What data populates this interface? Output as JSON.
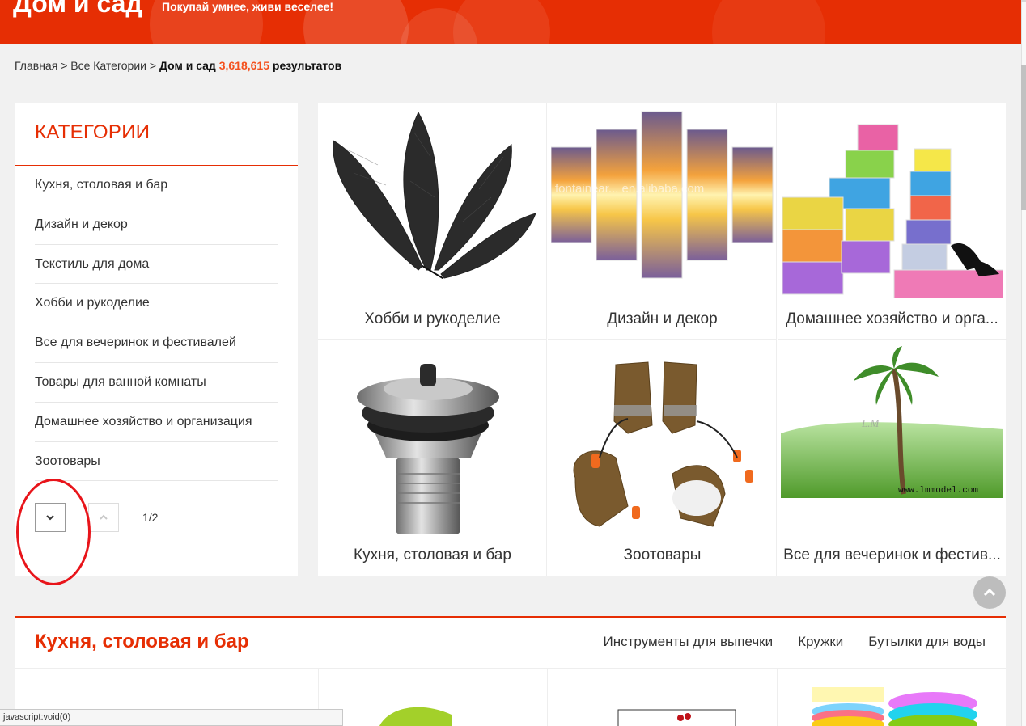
{
  "banner": {
    "title": "Дом и сад",
    "slogan": "Покупай умнее, живи веселее!"
  },
  "breadcrumb": {
    "home": "Главная",
    "sep": ">",
    "all": "Все Категории",
    "current": "Дом и сад",
    "count": "3,618,615",
    "results": "результатов"
  },
  "categories": {
    "title": "КАТЕГОРИИ",
    "items": [
      "Кухня, столовая и бар",
      "Дизайн и декор",
      "Текстиль для дома",
      "Хобби и рукоделие",
      "Все для вечеринок и фестивалей",
      "Товары для ванной комнаты",
      "Домашнее хозяйство и организация",
      "Зоотовары"
    ],
    "pager": "1/2"
  },
  "grid": {
    "cells": [
      {
        "label": "Хобби и рукоделие",
        "image": "black-feathers"
      },
      {
        "label": "Дизайн и декор",
        "image": "sunset-canvas-panels"
      },
      {
        "label": "Домашнее хозяйство и орга...",
        "image": "colorful-shoe-boxes"
      },
      {
        "label": "Кухня, столовая и бар",
        "image": "sink-drain-strainer"
      },
      {
        "label": "Зоотовары",
        "image": "pet-boots"
      },
      {
        "label": "Все для вечеринок и фестив...",
        "image": "model-palm-tree"
      }
    ],
    "watermark_decor": "fontainear... en.alibaba.com",
    "watermark_palm": "www.lmmodel.com",
    "watermark_palm_mark": "L.M"
  },
  "section": {
    "title": "Кухня, столовая и бар",
    "links": [
      "Инструменты для выпечки",
      "Кружки",
      "Бутылки для воды"
    ]
  },
  "status": "javascript:void(0)",
  "colors": {
    "brand_red": "#e62e04",
    "count_orange": "#f4511e",
    "annotation_red": "#e8141a"
  }
}
